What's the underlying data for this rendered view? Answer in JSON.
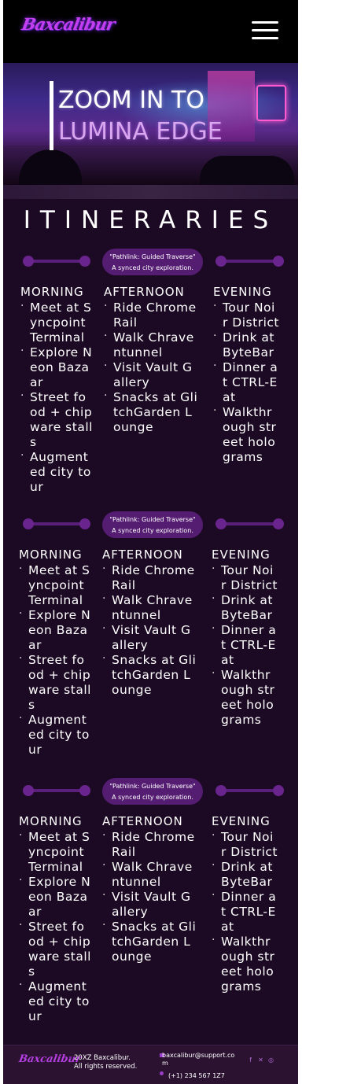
{
  "header": {
    "logo": "Baxcalibur",
    "menu_icon": "hamburger-menu-icon"
  },
  "hero": {
    "line1": "ZOOM IN TO",
    "line2": "LUMINA EDGE"
  },
  "section_title": "ITINERARIES",
  "itineraries": [
    {
      "pill_title": "\"Pathlink: Guided Traverse\"",
      "pill_subtitle": "A synced city exploration.",
      "morning": {
        "heading": "MORNING",
        "items": [
          "Meet at Syncpoint Terminal",
          "Explore Neon Bazaar",
          "Street food + chipware stalls",
          "Augmented city tour"
        ]
      },
      "afternoon": {
        "heading": "AFTERNOON",
        "items": [
          "Ride Chrome Rail",
          "Walk Chraventunnel",
          "Visit Vault Gallery",
          "Snacks at GlitchGarden Lounge"
        ]
      },
      "evening": {
        "heading": "EVENING",
        "items": [
          "Tour Noir District",
          "Drink at ByteBar",
          "Dinner at CTRL-Eat",
          "Walkthrough street holograms"
        ]
      }
    },
    {
      "pill_title": "\"Pathlink: Guided Traverse\"",
      "pill_subtitle": "A synced city exploration.",
      "morning": {
        "heading": "MORNING",
        "items": [
          "Meet at Syncpoint Terminal",
          "Explore Neon Bazaar",
          "Street food + chipware stalls",
          "Augmented city tour"
        ]
      },
      "afternoon": {
        "heading": "AFTERNOON",
        "items": [
          "Ride Chrome Rail",
          "Walk Chraventunnel",
          "Visit Vault Gallery",
          "Snacks at GlitchGarden Lounge"
        ]
      },
      "evening": {
        "heading": "EVENING",
        "items": [
          "Tour Noir District",
          "Drink at ByteBar",
          "Dinner at CTRL-Eat",
          "Walkthrough street holograms"
        ]
      }
    },
    {
      "pill_title": "\"Pathlink: Guided Traverse\"",
      "pill_subtitle": "A synced city exploration.",
      "morning": {
        "heading": "MORNING",
        "items": [
          "Meet at Syncpoint Terminal",
          "Explore Neon Bazaar",
          "Street food + chipware stalls",
          "Augmented city tour"
        ]
      },
      "afternoon": {
        "heading": "AFTERNOON",
        "items": [
          "Ride Chrome Rail",
          "Walk Chraventunnel",
          "Visit Vault Gallery",
          "Snacks at GlitchGarden Lounge"
        ]
      },
      "evening": {
        "heading": "EVENING",
        "items": [
          "Tour Noir District",
          "Drink at ByteBar",
          "Dinner at CTRL-Eat",
          "Walkthrough street holograms"
        ]
      }
    }
  ],
  "footer": {
    "logo": "Baxcalibur",
    "copyright_line1": "20XZ Baxcalibur.",
    "copyright_line2": "All rights reserved.",
    "email": "baxcalibur@support.com",
    "phone": "(+1) 234 567 1Z7",
    "social_icons": [
      "facebook-icon",
      "x-icon",
      "instagram-icon"
    ]
  },
  "colors": {
    "accent": "#6a248e",
    "pill": "#551d72",
    "background": "#1c0a24",
    "header": "#000000"
  }
}
